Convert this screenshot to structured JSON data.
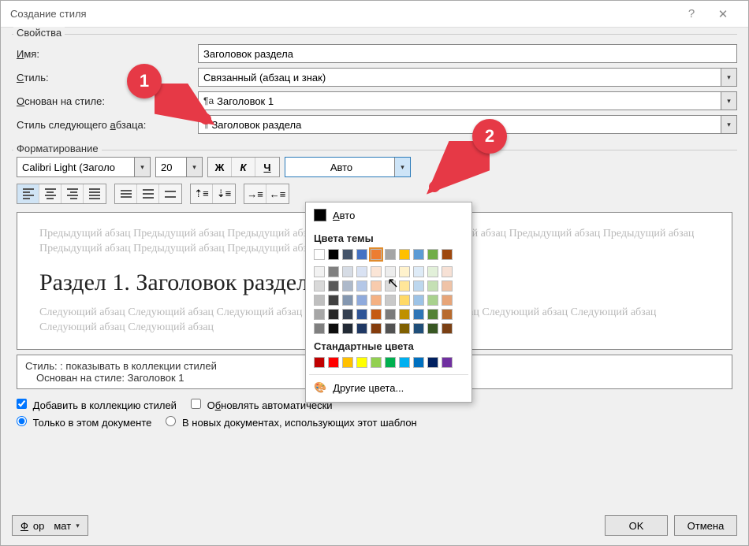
{
  "title": "Создание стиля",
  "properties": {
    "group_label": "Свойства",
    "name_label": "Имя:",
    "name_value": "Заголовок раздела",
    "style_label": "Стиль:",
    "style_value": "Связанный (абзац и знак)",
    "based_label": "Основан на стиле:",
    "based_value": "Заголовок 1",
    "next_label": "Стиль следующего абзаца:",
    "next_value": "Заголовок раздела"
  },
  "formatting": {
    "group_label": "Форматирование",
    "font": "Calibri Light (Заголо",
    "size": "20",
    "bold": "Ж",
    "italic": "К",
    "underline": "Ч",
    "color_label": "Авто"
  },
  "color_popup": {
    "auto": "Авто",
    "theme_label": "Цвета темы",
    "standard_label": "Стандартные цвета",
    "more": "Другие цвета...",
    "theme_row1": [
      "#ffffff",
      "#000000",
      "#44546a",
      "#4472c4",
      "#ed7d31",
      "#a5a5a5",
      "#ffc000",
      "#5b9bd5",
      "#70ad47",
      "#9e480e"
    ],
    "theme_shades": [
      [
        "#f2f2f2",
        "#808080",
        "#d6dce5",
        "#d9e2f3",
        "#fbe5d6",
        "#ededed",
        "#fff2cc",
        "#deebf7",
        "#e2f0d9",
        "#f7e1d5"
      ],
      [
        "#d9d9d9",
        "#595959",
        "#adb9ca",
        "#b4c7e7",
        "#f8cbad",
        "#dbdbdb",
        "#ffe699",
        "#bdd7ee",
        "#c5e0b4",
        "#efc3a7"
      ],
      [
        "#bfbfbf",
        "#404040",
        "#8497b0",
        "#8faadc",
        "#f4b183",
        "#c9c9c9",
        "#ffd966",
        "#9dc3e6",
        "#a9d18e",
        "#e7a579"
      ],
      [
        "#a6a6a6",
        "#262626",
        "#333f50",
        "#2f5597",
        "#c55a11",
        "#7b7b7b",
        "#bf9000",
        "#2e75b6",
        "#548235",
        "#b86b2e"
      ],
      [
        "#7f7f7f",
        "#0d0d0d",
        "#222a35",
        "#1f3864",
        "#843c0c",
        "#525252",
        "#806000",
        "#1f4e79",
        "#385723",
        "#7a4014"
      ]
    ],
    "standard": [
      "#c00000",
      "#ff0000",
      "#ffc000",
      "#ffff00",
      "#92d050",
      "#00b050",
      "#00b0f0",
      "#0070c0",
      "#002060",
      "#7030a0"
    ]
  },
  "preview": {
    "prev_para": "Предыдущий абзац Предыдущий абзац Предыдущий абзац Предыдущий абзац Предыдущий абзац Предыдущий абзац Предыдущий абзац Предыдущий абзац Предыдущий абзац Предыдущий абзац",
    "heading": "Раздел 1. Заголовок раздела",
    "next_para": "Следующий абзац Следующий абзац Следующий абзац Следующий абзац Следующий абзац Следующий абзац Следующий абзац Следующий абзац Следующий абзац"
  },
  "summary": {
    "line1": "Стиль: : показывать в коллекции стилей",
    "line2": "Основан на стиле: Заголовок 1"
  },
  "checks": {
    "add_collection": "Добавить в коллекцию стилей",
    "auto_update": "Обновлять автоматически",
    "only_doc": "Только в этом документе",
    "new_docs": "В новых документах, использующих этот шаблон"
  },
  "buttons": {
    "format": "Формат",
    "ok": "OK",
    "cancel": "Отмена"
  },
  "annotations": {
    "b1": "1",
    "b2": "2"
  }
}
